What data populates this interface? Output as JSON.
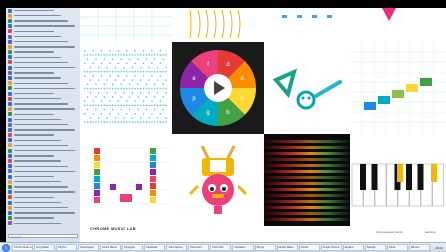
{
  "colors": {
    "rainbow": [
      "#e53935",
      "#fb8c00",
      "#fdd835",
      "#43a047",
      "#00acc1",
      "#1e88e5",
      "#8e24aa",
      "#ec407a"
    ],
    "wheel_letters": [
      "d",
      "a",
      "c",
      "b",
      "g",
      "p",
      "e",
      "f"
    ]
  },
  "main": {
    "caption": "CHROME MUSIC LAB",
    "link_left": "chromeexperiments",
    "link_right": "learning"
  },
  "sidebar": {
    "search_placeholder": "Search",
    "items": [
      {
        "color": "#2f6fd6"
      },
      {
        "color": "#e4a12b"
      },
      {
        "color": "#3e8f3e"
      },
      {
        "color": "#2f6fd6"
      },
      {
        "color": "#d84a4a"
      },
      {
        "color": "#7b5cc9"
      },
      {
        "color": "#2f6fd6"
      },
      {
        "color": "#e4a12b"
      },
      {
        "color": "#3e8f3e"
      },
      {
        "color": "#2f6fd6"
      },
      {
        "color": "#d84a4a"
      },
      {
        "color": "#2f6fd6"
      },
      {
        "color": "#7b5cc9"
      },
      {
        "color": "#2f6fd6"
      },
      {
        "color": "#e4a12b"
      },
      {
        "color": "#3e8f3e"
      },
      {
        "color": "#2f6fd6"
      },
      {
        "color": "#d84a4a"
      },
      {
        "color": "#2f6fd6"
      },
      {
        "color": "#e4a12b"
      },
      {
        "color": "#3e8f3e"
      },
      {
        "color": "#2f6fd6"
      },
      {
        "color": "#7b5cc9"
      },
      {
        "color": "#2f6fd6"
      },
      {
        "color": "#d84a4a"
      },
      {
        "color": "#2f6fd6"
      },
      {
        "color": "#e4a12b"
      },
      {
        "color": "#3e8f3e"
      },
      {
        "color": "#2f6fd6"
      },
      {
        "color": "#d84a4a"
      },
      {
        "color": "#2f6fd6"
      },
      {
        "color": "#7b5cc9"
      },
      {
        "color": "#2f6fd6"
      },
      {
        "color": "#e4a12b"
      },
      {
        "color": "#3e8f3e"
      },
      {
        "color": "#2f6fd6"
      },
      {
        "color": "#d84a4a"
      },
      {
        "color": "#2f6fd6"
      },
      {
        "color": "#e4a12b"
      },
      {
        "color": "#2f6fd6"
      },
      {
        "color": "#3e8f3e"
      },
      {
        "color": "#7b5cc9"
      }
    ]
  },
  "taskbar": {
    "tasks": [
      "Chrome Music Lab",
      "Song Maker",
      "Rhythm",
      "Spectrogram",
      "Sound Waves",
      "Arpeggios",
      "Kandinsky",
      "Voice Spinner",
      "Harmonics",
      "Piano Roll",
      "Oscillators",
      "Strings",
      "Melody Maker",
      "Chords",
      "Google Chrome",
      "Explorer",
      "Settings",
      "Folder",
      "Window"
    ],
    "clock": "10:24"
  }
}
